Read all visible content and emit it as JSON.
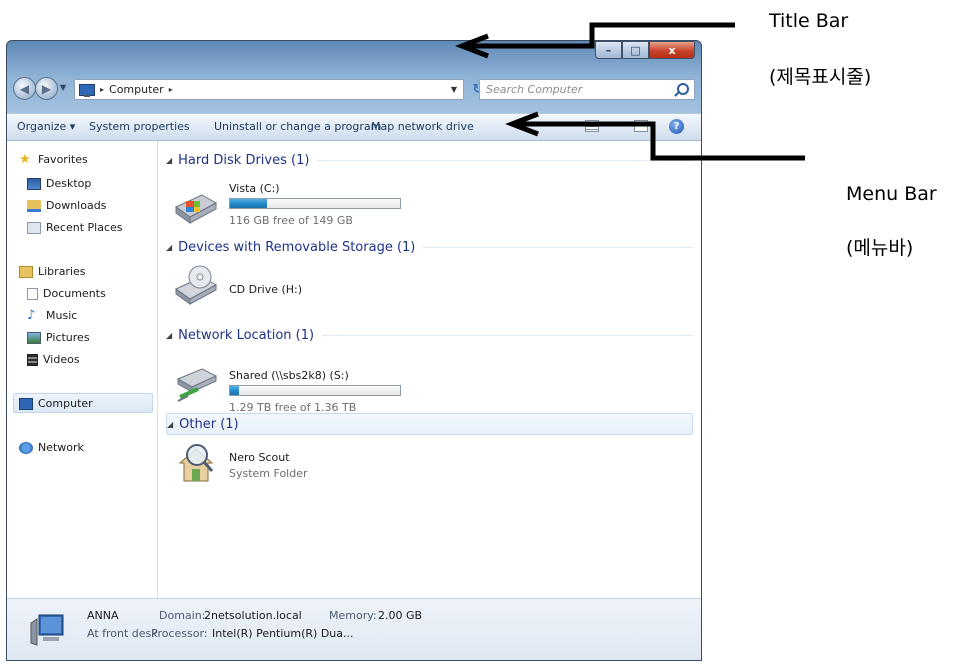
{
  "window": {
    "caption_buttons": {
      "minimize": "–",
      "maximize": "□",
      "close": "x"
    }
  },
  "address_bar": {
    "location": "Computer",
    "separator": "▸",
    "search_placeholder": "Search Computer",
    "refresh_icon": "↻"
  },
  "toolbar": {
    "organize": "Organize ▾",
    "system_properties": "System properties",
    "uninstall": "Uninstall or change a program",
    "map_drive": "Map network drive",
    "help": "?"
  },
  "nav_pane": {
    "favorites": "Favorites",
    "desktop": "Desktop",
    "downloads": "Downloads",
    "recent_places": "Recent Places",
    "libraries": "Libraries",
    "documents": "Documents",
    "music": "Music",
    "pictures": "Pictures",
    "videos": "Videos",
    "computer": "Computer",
    "network": "Network"
  },
  "groups": {
    "hdd": {
      "header": "Hard Disk Drives (1)",
      "drive_name": "Vista (C:)",
      "free_text": "116 GB free of 149 GB",
      "used_fraction": 0.22
    },
    "removable": {
      "header": "Devices with Removable Storage (1)",
      "drive_name": "CD Drive (H:)"
    },
    "network": {
      "header": "Network Location (1)",
      "drive_name": "Shared (\\\\sbs2k8) (S:)",
      "free_text": "1.29 TB free of 1.36 TB",
      "used_fraction": 0.05
    },
    "other": {
      "header": "Other (1)",
      "item_name": "Nero Scout",
      "item_type": "System Folder"
    }
  },
  "details": {
    "computer_name": "ANNA",
    "description": "At front desk",
    "domain_label": "Domain:",
    "domain_value": "2netsolution.local",
    "memory_label": "Memory:",
    "memory_value": "2.00 GB",
    "processor_label": "Processor:",
    "processor_value": "Intel(R) Pentium(R) Dua..."
  },
  "annotations": {
    "title_bar": "Title Bar",
    "title_bar_ko": "(제목표시줄)",
    "menu_bar": "Menu Bar",
    "menu_bar_ko": "(메뉴바)"
  },
  "colors": {
    "title_gradient_top": "#5f88b5",
    "close_button": "#c8442a",
    "group_header_text": "#1e3287",
    "capacity_fill": "#2185c5"
  }
}
